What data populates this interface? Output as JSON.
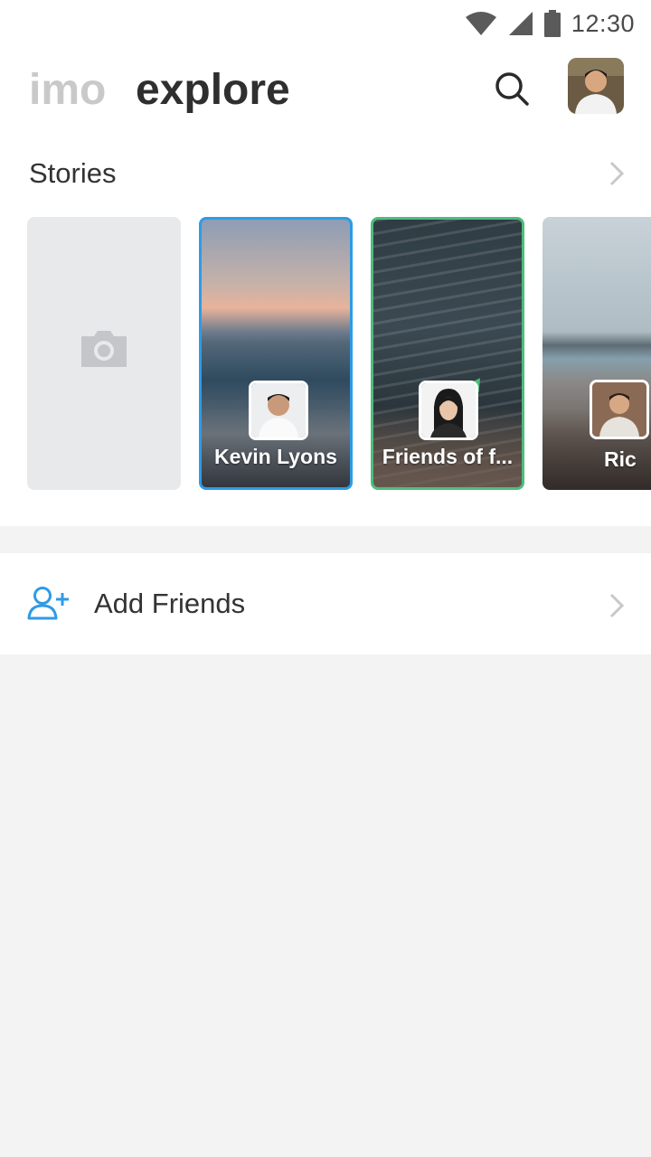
{
  "status_bar": {
    "time": "12:30",
    "icons": [
      "wifi-icon",
      "cell-signal-icon",
      "battery-icon"
    ]
  },
  "header": {
    "tabs": [
      {
        "label": "imo",
        "active": false
      },
      {
        "label": "explore",
        "active": true
      }
    ],
    "search_icon": "search-icon",
    "avatar": "user-avatar"
  },
  "stories": {
    "title": "Stories",
    "more_icon": "chevron-right-icon",
    "camera_icon": "camera-icon",
    "items": [
      {
        "name": "Kevin Lyons",
        "ring_color": "#2e9be6"
      },
      {
        "name": "Friends of f...",
        "ring_color": "#4dbd7b"
      },
      {
        "name": "Ric",
        "ring_color": null
      }
    ]
  },
  "add_friends": {
    "label": "Add Friends",
    "icon": "add-friend-icon",
    "chevron": "chevron-right-icon",
    "accent": "#2e9be6"
  }
}
